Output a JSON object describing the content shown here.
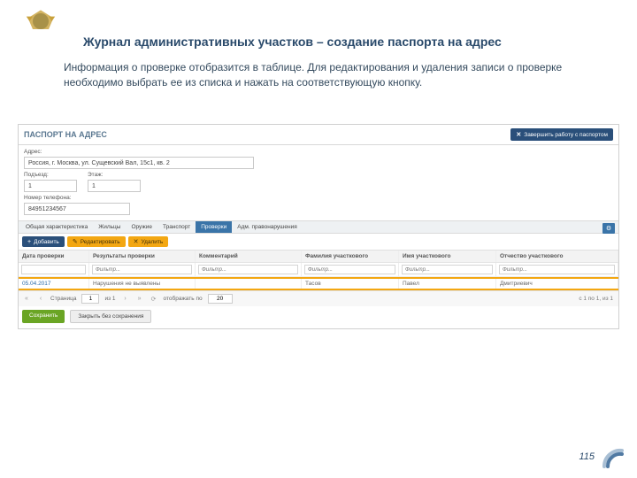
{
  "slide": {
    "title": "Журнал административных участков – создание паспорта на адрес",
    "desc": "Информация о проверке отобразится в таблице. Для редактирования и удаления записи о проверке необходимо выбрать ее из списка и нажать на соответствующую кнопку.",
    "page": "115"
  },
  "header": {
    "title": "ПАСПОРТ НА АДРЕС",
    "end_button": "Завершить работу с паспортом"
  },
  "form": {
    "address_label": "Адрес:",
    "address_value": "Россия, г. Москва, ул. Сущевский Вал, 15с1, кв. 2",
    "entrance_label": "Подъезд:",
    "entrance_value": "1",
    "floor_label": "Этаж:",
    "floor_value": "1",
    "phone_label": "Номер телефона:",
    "phone_value": "84951234567"
  },
  "tabs": {
    "items": [
      {
        "label": "Общая характеристика"
      },
      {
        "label": "Жильцы"
      },
      {
        "label": "Оружие"
      },
      {
        "label": "Транспорт"
      },
      {
        "label": "Проверки"
      },
      {
        "label": "Адм. правонарушения"
      }
    ],
    "active_index": 4
  },
  "toolbar": {
    "add": "Добавить",
    "edit": "Редактировать",
    "delete": "Удалить"
  },
  "grid": {
    "columns": [
      "Дата проверки",
      "Результаты проверки",
      "Комментарий",
      "Фамилия участкового",
      "Имя участкового",
      "Отчество участкового"
    ],
    "filter_placeholder": "Фильтр...",
    "row": {
      "date": "05.04.2017",
      "result": "Нарушения не выявлены",
      "comment": "",
      "last": "Тасов",
      "first": "Павел",
      "middle": "Дмитриевич"
    }
  },
  "pager": {
    "page_label": "Страница",
    "page_value": "1",
    "of": "из 1",
    "show_label": "отображать по",
    "per_page": "20",
    "status": "с 1 по 1, из 1"
  },
  "footer": {
    "save": "Сохранить",
    "cancel": "Закрыть без сохранения"
  },
  "colors": {
    "brand": "#2a4f7a",
    "accent": "#f3a712"
  }
}
